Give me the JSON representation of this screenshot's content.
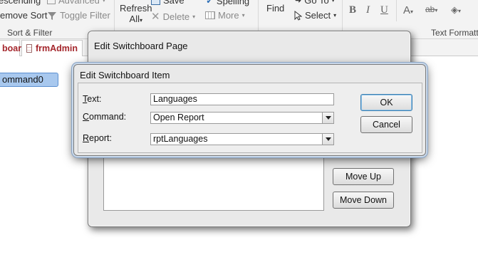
{
  "ribbon": {
    "sort_filter": {
      "descending": "escending",
      "remove_sort": "emove Sort",
      "advanced": "Advanced",
      "toggle_filter": "Toggle Filter",
      "group_label": "Sort & Filter"
    },
    "records": {
      "refresh_all_line1": "Refresh",
      "refresh_all_line2": "All",
      "save": "Save",
      "delete": "Delete",
      "spelling": "Spelling",
      "more": "More"
    },
    "find": {
      "find": "Find",
      "goto": "Go To",
      "select": "Select"
    },
    "text_formatting": {
      "bold": "B",
      "italic": "I",
      "underline": "U",
      "font_color": "A",
      "highlight": "ab",
      "group_label": "Text Formatti"
    }
  },
  "tabs": [
    {
      "label": "board"
    },
    {
      "label": "frmAdmin"
    }
  ],
  "form": {
    "command_button": "ommand0"
  },
  "switchboard_page_dialog": {
    "title": "Edit Switchboard Page",
    "buttons": {
      "move_up": "Move Up",
      "move_down": "Move Down"
    }
  },
  "switchboard_item_dialog": {
    "title": "Edit Switchboard Item",
    "text_label": "Text:",
    "text_value": "Languages",
    "command_label": "Command:",
    "command_value": "Open Report",
    "report_label": "Report:",
    "report_value": "rptLanguages",
    "ok": "OK",
    "cancel": "Cancel"
  }
}
